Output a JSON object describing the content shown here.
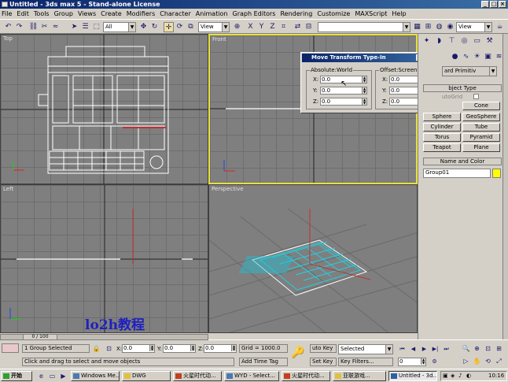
{
  "window": {
    "title": "Untitled - 3ds max 5 - Stand-alone License"
  },
  "menu": [
    "File",
    "Edit",
    "Tools",
    "Group",
    "Views",
    "Create",
    "Modifiers",
    "Character",
    "Animation",
    "Graph Editors",
    "Rendering",
    "Customize",
    "MAXScript",
    "Help"
  ],
  "toolbar": {
    "selection_filter": "All",
    "coord_system": "View",
    "view_right": "View",
    "named_sel": ""
  },
  "viewports": {
    "top": "Top",
    "front": "Front",
    "left": "Left",
    "perspective": "Perspective"
  },
  "dialog": {
    "title": "Move Transform Type-In",
    "absolute_title": "Absolute:World",
    "offset_title": "Offset:Screen",
    "abs": {
      "x_label": "X:",
      "x": "0.0",
      "y_label": "Y:",
      "y": "0.0",
      "z_label": "Z:",
      "z": "0.0"
    },
    "off": {
      "x_label": "X:",
      "x": "0.0",
      "y_label": "Y:",
      "y": "0.0",
      "z_label": "Z:",
      "z": "0.0"
    }
  },
  "cmd": {
    "category": "ard Primitiv",
    "object_type_header": "bject Type",
    "autogrid": "utoGrid",
    "buttons": [
      "Cone",
      "Sphere",
      "GeoSphere",
      "Cylinder",
      "Tube",
      "Torus",
      "Pyramid",
      "Teapot",
      "Plane"
    ],
    "name_color_header": "Name and Color",
    "object_name": "Group01",
    "object_color": "#ffff00"
  },
  "status": {
    "timeslider": "0 / 100",
    "selection": "1 Group Selected",
    "x_label": "X:",
    "x": "0.0",
    "y_label": "Y:",
    "y": "0.0",
    "z_label": "Z:",
    "z": "0.0",
    "grid": "Grid = 1000.0",
    "prompt": "Click and drag to select and move objects",
    "add_time_tag": "Add Time Tag",
    "auto_key": "uto Key",
    "key_sel": "Selected",
    "set_key": "Set Key",
    "key_filters": "Key Filters...",
    "frame": "0"
  },
  "watermark": "lo2h教程",
  "taskbar": {
    "start": "开始",
    "items": [
      "Windows Me...",
      "DWG",
      "火星时代动...",
      "WYD - Select...",
      "火星时代动...",
      "亚联游戏...",
      "Untitled - 3d..."
    ],
    "clock": "10:16"
  }
}
